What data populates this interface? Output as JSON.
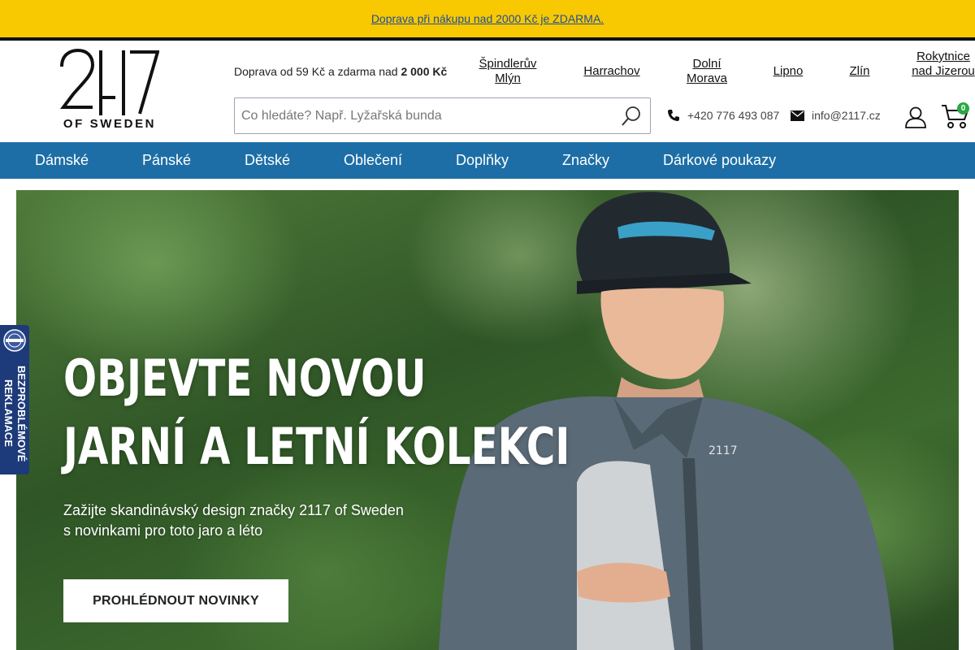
{
  "promo": {
    "text": "Doprava při nákupu nad 2000 Kč je ZDARMA."
  },
  "logo": {
    "number": "2117",
    "tagline": "OF SWEDEN"
  },
  "header": {
    "shipping_prefix": "Doprava od 59 Kč a zdarma nad ",
    "shipping_amount": "2 000 Kč",
    "stores": [
      {
        "label": "Špindlerův Mlýn"
      },
      {
        "label": "Harrachov"
      },
      {
        "label": "Dolní Morava"
      },
      {
        "label": "Lipno"
      },
      {
        "label": "Zlín"
      },
      {
        "label": "Rokytnice nad Jizerou"
      }
    ],
    "search_placeholder": "Co hledáte? Např. Lyžařská bunda",
    "phone": "+420 776 493 087",
    "email": "info@2117.cz",
    "cart_count": "0"
  },
  "nav": {
    "items": [
      {
        "label": "Dámské"
      },
      {
        "label": "Pánské"
      },
      {
        "label": "Dětské"
      },
      {
        "label": "Oblečení"
      },
      {
        "label": "Doplňky"
      },
      {
        "label": "Značky"
      },
      {
        "label": "Dárkové poukazy"
      }
    ]
  },
  "hero": {
    "title_line1": "OBJEVTE NOVOU",
    "title_line2": "JARNÍ A LETNÍ KOLEKCI",
    "subtitle_line1": "Zažijte skandinávský design značky 2117 of Sweden",
    "subtitle_line2": "s novinkami pro toto jaro a léto",
    "cta": "PROHLÉDNOUT NOVINKY"
  },
  "side_badge": {
    "text": "BEZPROBLÉMOVÉ REKLAMACE"
  },
  "colors": {
    "promo_bg": "#f8c800",
    "nav_bg": "#1d6ea6",
    "badge_bg": "#1d3a7a",
    "cart_badge": "#27a844",
    "promo_link": "#1f4e9a"
  }
}
